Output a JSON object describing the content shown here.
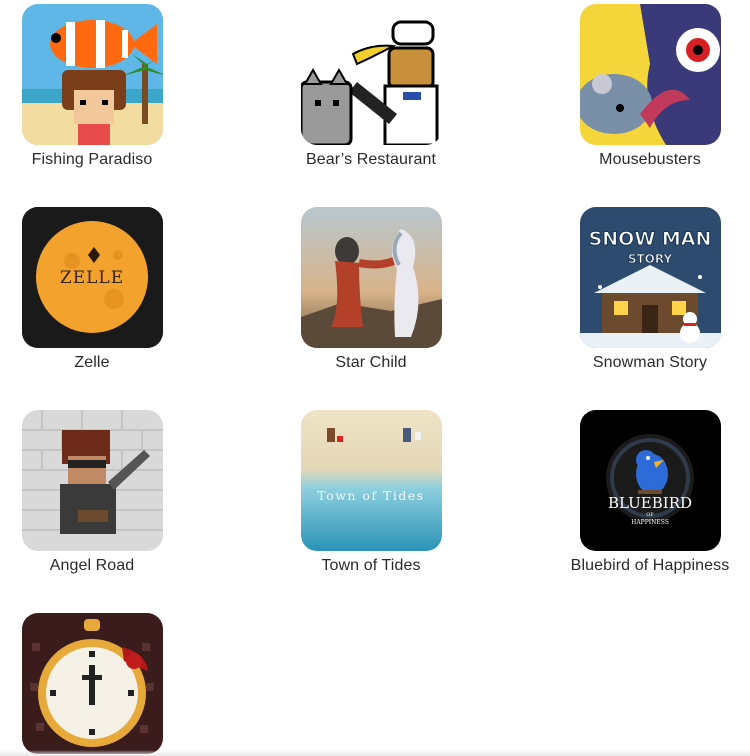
{
  "apps": [
    {
      "title": "Fishing Paradiso",
      "icon": "fishing-paradiso-icon"
    },
    {
      "title": "Bear’s Restaurant",
      "icon": "bears-restaurant-icon"
    },
    {
      "title": "Mousebusters",
      "icon": "mousebusters-icon"
    },
    {
      "title": "Zelle",
      "icon": "zelle-icon",
      "icon_text": "ZELLE"
    },
    {
      "title": "Star Child",
      "icon": "star-child-icon"
    },
    {
      "title": "Snowman Story",
      "icon": "snowman-story-icon",
      "icon_text": [
        "SNOW MAN",
        "STORY"
      ]
    },
    {
      "title": "Angel Road",
      "icon": "angel-road-icon"
    },
    {
      "title": "Town of Tides",
      "icon": "town-of-tides-icon",
      "icon_text": "Town of Tides"
    },
    {
      "title": "Bluebird of Happiness",
      "icon": "bluebird-of-happiness-icon",
      "icon_text": [
        "BLUEBIRD",
        "OF",
        "HAPPINESS"
      ]
    },
    {
      "title": "",
      "icon": "pocket-watch-icon"
    }
  ],
  "colors": {
    "label_text": "#2b2b2b",
    "zelle_moon": "#f2a22d",
    "bluebird_bg": "#000000"
  }
}
